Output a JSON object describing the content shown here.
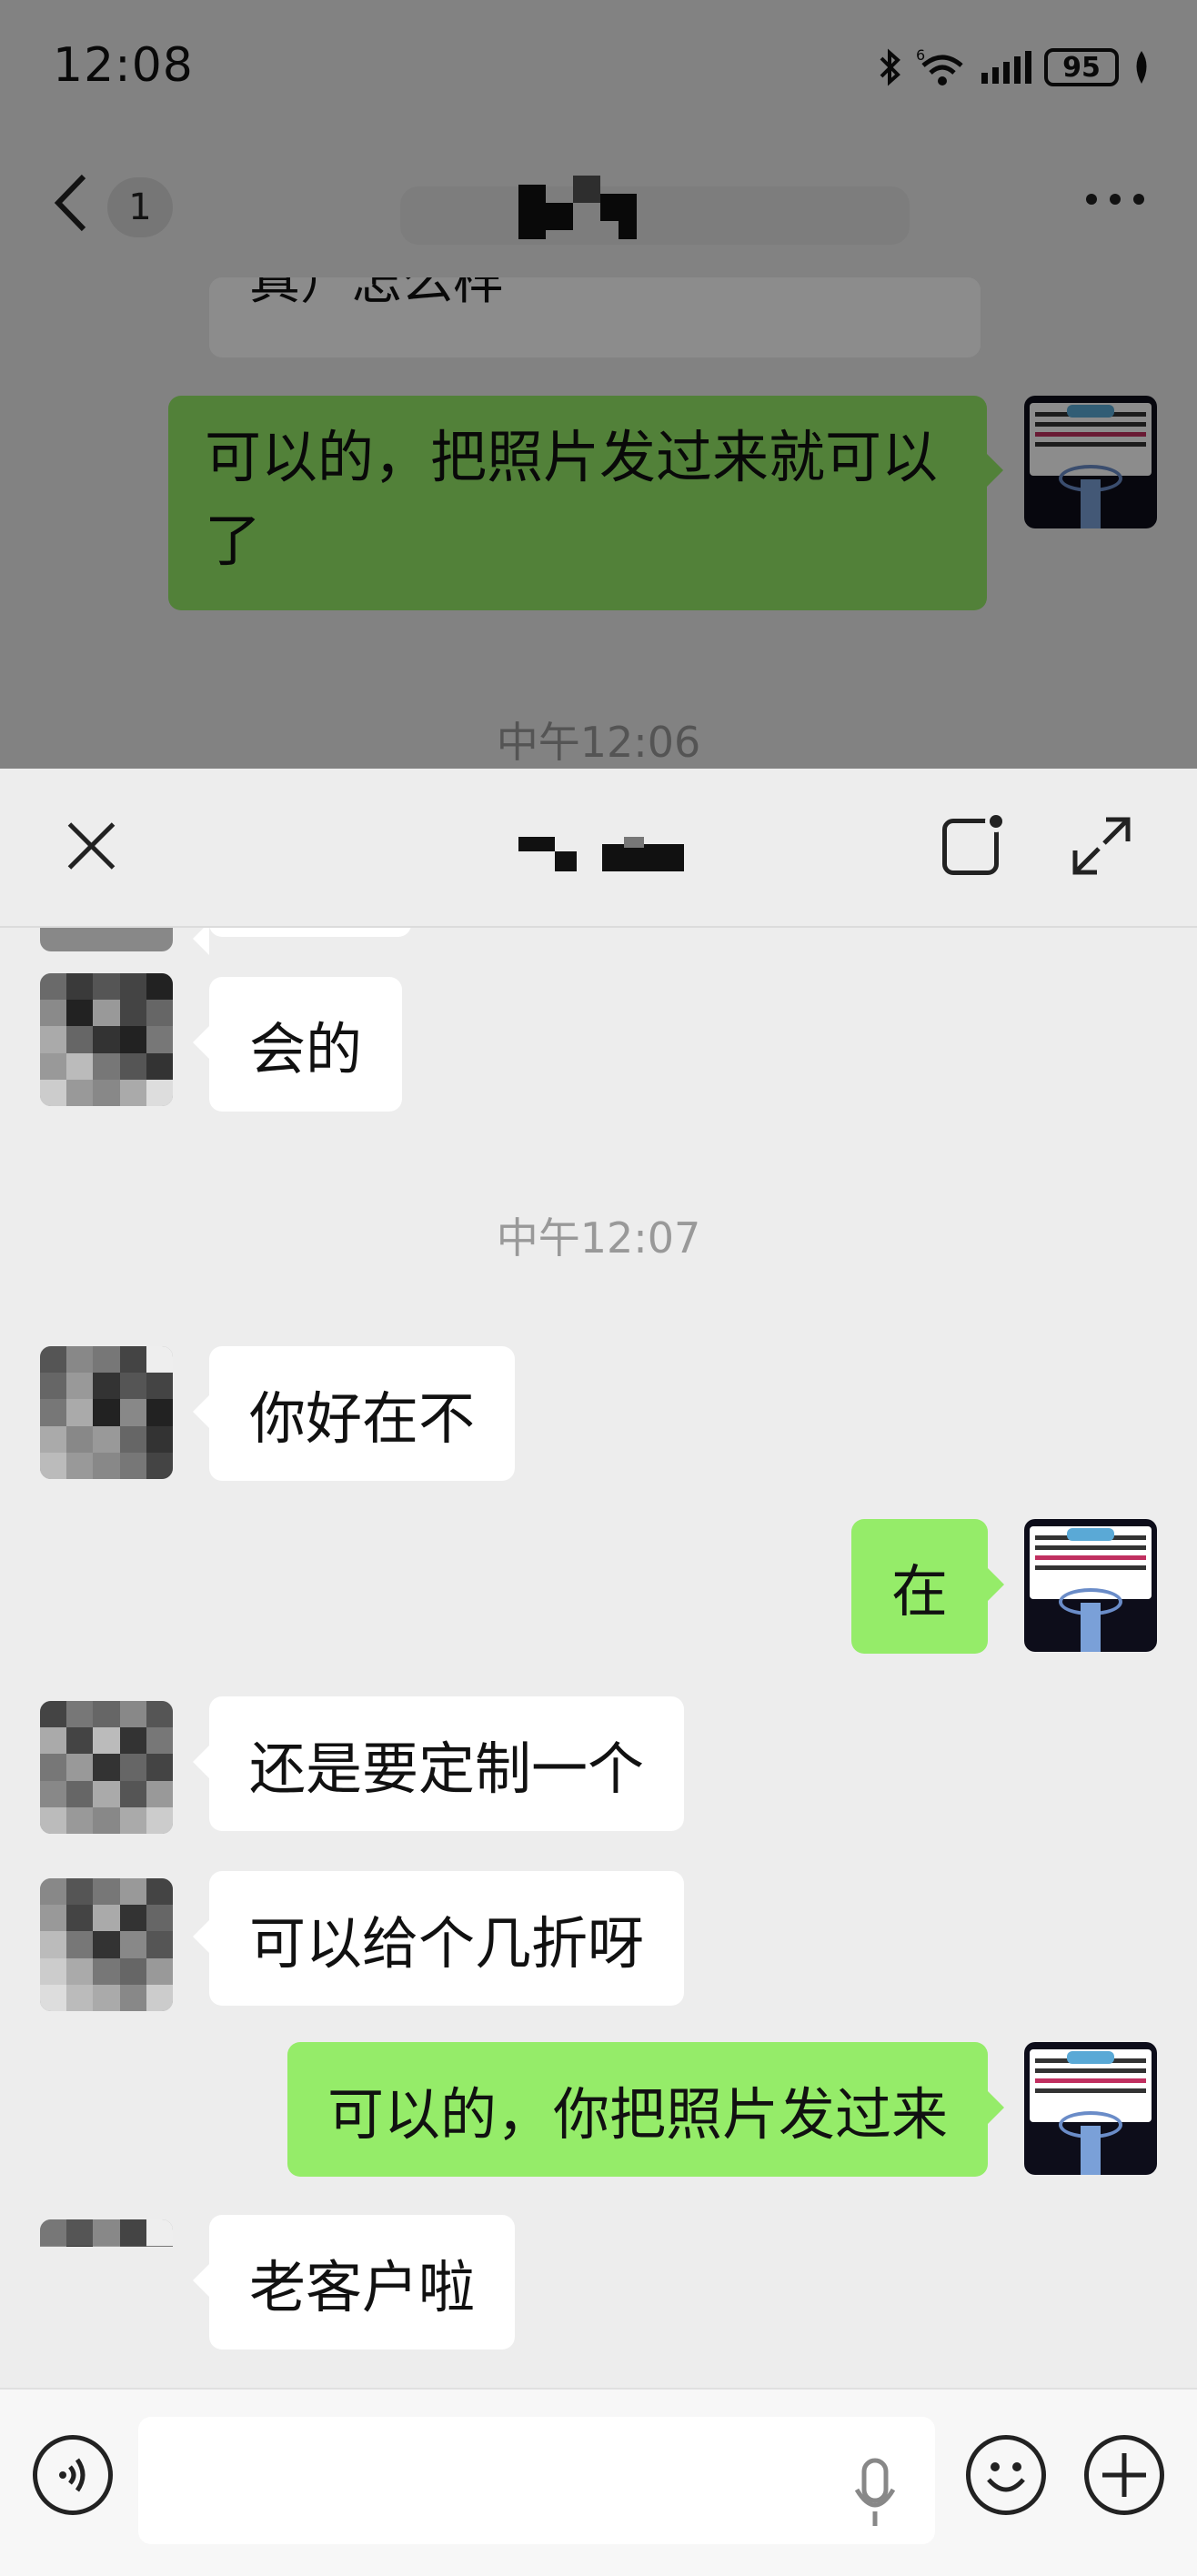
{
  "status_bar": {
    "time": "12:08",
    "battery": "95",
    "network": "6"
  },
  "background_chat": {
    "unread_count": "1",
    "partial_message": "真）怎么样",
    "green_message": "可以的，把照片发过来就可以了",
    "timestamp": "中午12:06"
  },
  "messages": [
    {
      "id": "m1",
      "side": "in",
      "text": "会的"
    },
    {
      "id": "t1",
      "type": "time",
      "text": "中午12:07"
    },
    {
      "id": "m2",
      "side": "in",
      "text": "你好在不"
    },
    {
      "id": "m3",
      "side": "out",
      "text": "在"
    },
    {
      "id": "m4",
      "side": "in",
      "text": "还是要定制一个"
    },
    {
      "id": "m5",
      "side": "in",
      "text": "可以给个几折呀"
    },
    {
      "id": "m6",
      "side": "out",
      "text": "可以的，你把照片发过来"
    },
    {
      "id": "m7",
      "side": "in",
      "text": "老客户啦"
    }
  ],
  "colors": {
    "incoming": "#ffffff",
    "outgoing": "#95ec69",
    "background": "#ededed"
  },
  "icons": {
    "back": "chevron-left-icon",
    "more": "more-dots-icon",
    "close": "close-icon",
    "float": "floating-window-icon",
    "expand": "expand-icon",
    "voice": "voice-mode-icon",
    "mic": "microphone-icon",
    "emoji": "emoji-icon",
    "plus": "plus-icon"
  },
  "input": {
    "value": "",
    "placeholder": ""
  }
}
